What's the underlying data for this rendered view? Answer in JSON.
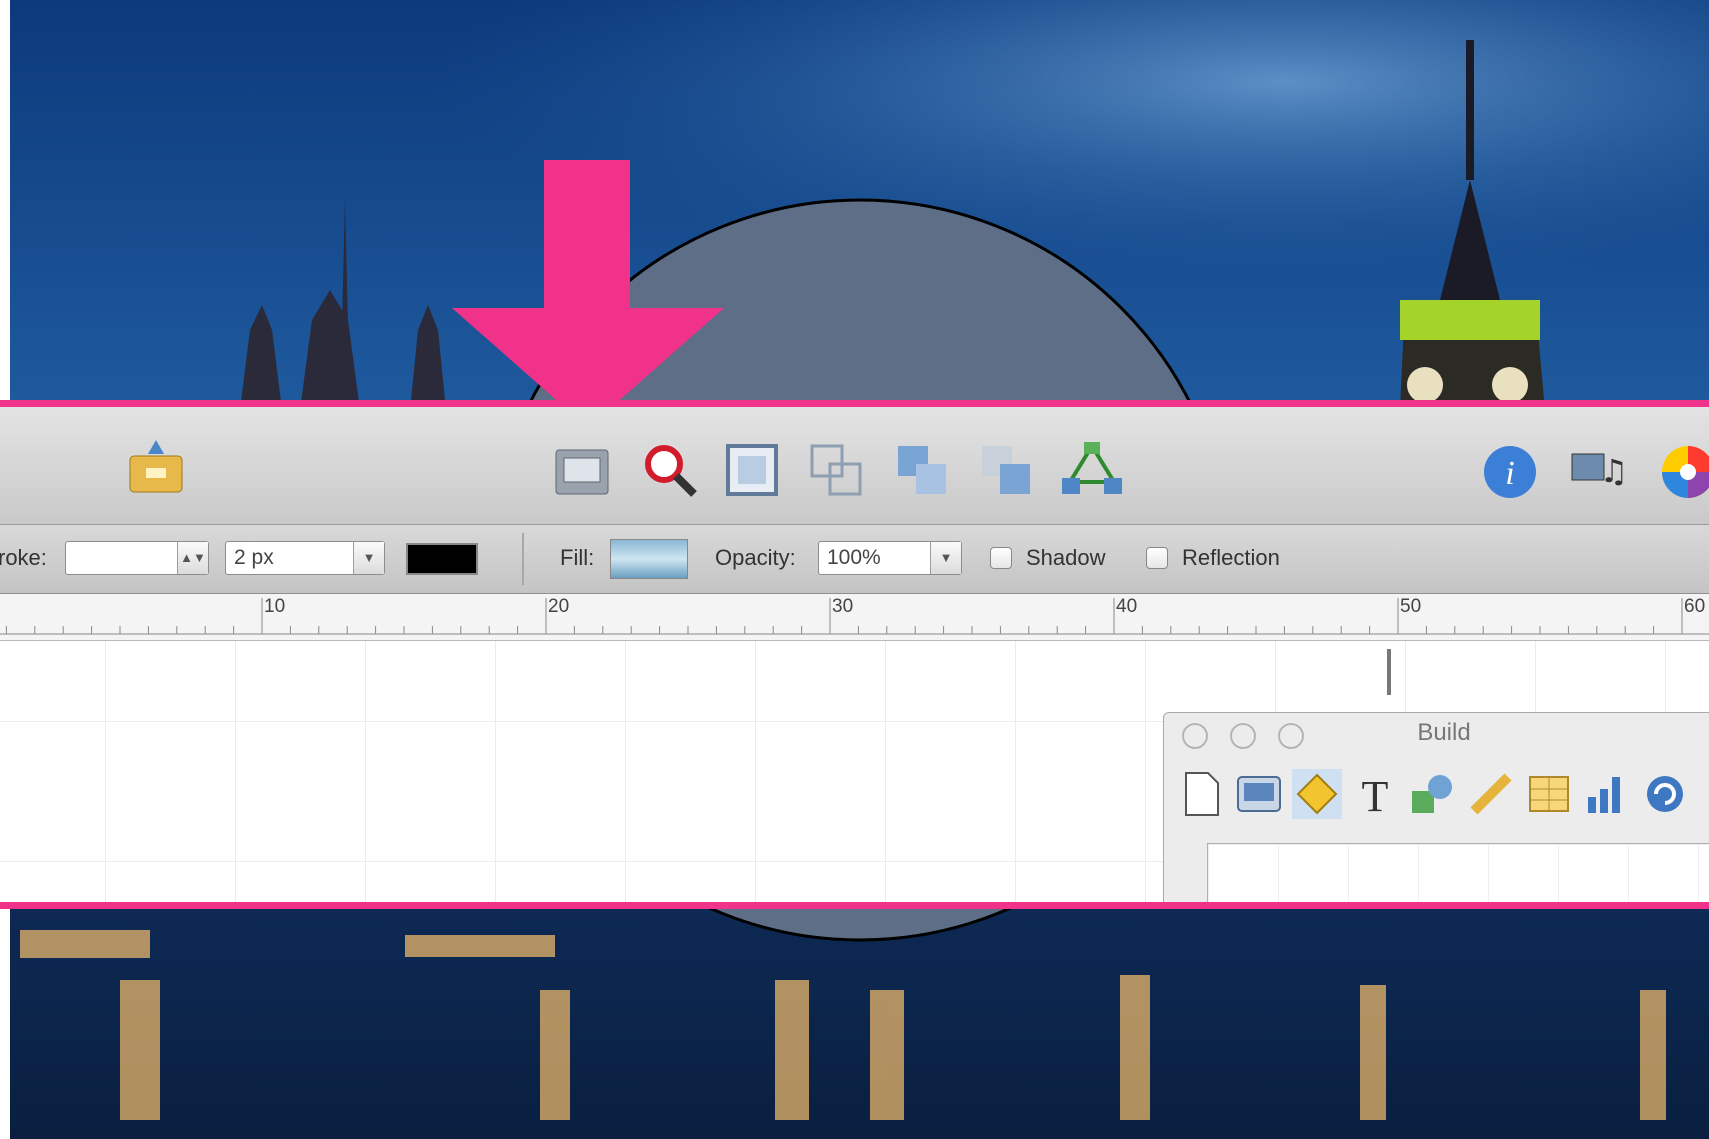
{
  "toolbar": {
    "icons": [
      "share-folder-icon",
      "slide-view-icon",
      "zoom-tool-icon",
      "crop-frame-icon",
      "front-icon",
      "group-icon",
      "back-icon",
      "connection-icon",
      "info-icon",
      "media-icon",
      "color-wheel-icon"
    ]
  },
  "format_bar": {
    "stroke_label": "roke:",
    "stroke_style_value": "",
    "stroke_width_value": "2 px",
    "stroke_color": "#000000",
    "fill_label": "Fill:",
    "opacity_label": "Opacity:",
    "opacity_value": "100%",
    "shadow_label": "Shadow",
    "reflection_label": "Reflection"
  },
  "ruler": {
    "ticks": [
      "10",
      "20",
      "30",
      "40",
      "50",
      "60"
    ]
  },
  "build_panel": {
    "title": "Build",
    "icons": [
      "blank-document-icon",
      "slide-icon",
      "shape-diamond-icon",
      "text-T-icon",
      "shapes-icon",
      "pencil-icon",
      "table-icon",
      "bar-chart-icon",
      "refresh-icon"
    ]
  },
  "annotation": {
    "arrow_color": "#f0328b",
    "highlight_color": "#f0328b"
  }
}
